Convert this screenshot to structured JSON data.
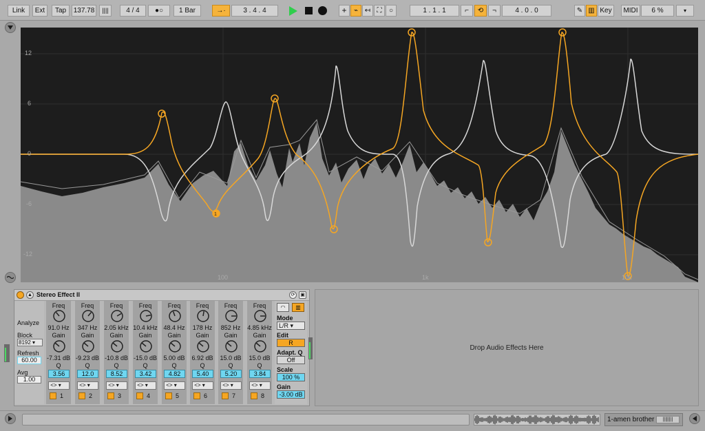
{
  "transport": {
    "link": "Link",
    "ext": "Ext",
    "tap": "Tap",
    "tempo": "137.78",
    "time_sig": "4 / 4",
    "metro": "●○",
    "quantize": "1 Bar",
    "position": "3 .   4 .   4",
    "loop_start": "1 .   1 .   1",
    "loop_length": "4 .   0 .   0",
    "key": "Key",
    "midi": "MIDI",
    "cpu": "6 %"
  },
  "eq_display": {
    "y_ticks": [
      "12",
      "6",
      "0",
      "-6",
      "-12"
    ],
    "x_ticks": [
      "100",
      "1k",
      "10k"
    ]
  },
  "device": {
    "title": "Stereo Effect II",
    "analyze": "Analyze",
    "block_label": "Block",
    "block_value": "8192",
    "refresh_label": "Refresh",
    "refresh_value": "60.00",
    "avg_label": "Avg",
    "avg_value": "1.00",
    "freq_label": "Freq",
    "gain_label": "Gain",
    "q_label": "Q",
    "bands": [
      {
        "freq": "91.0 Hz",
        "gain": "-7.31 dB",
        "q": "3.56",
        "num": "1"
      },
      {
        "freq": "347 Hz",
        "gain": "-9.23 dB",
        "q": "12.0",
        "num": "2"
      },
      {
        "freq": "2.05 kHz",
        "gain": "-10.8 dB",
        "q": "8.52",
        "num": "3"
      },
      {
        "freq": "10.4 kHz",
        "gain": "-15.0 dB",
        "q": "3.42",
        "num": "4"
      },
      {
        "freq": "48.4 Hz",
        "gain": "5.00 dB",
        "q": "4.82",
        "num": "5"
      },
      {
        "freq": "178 Hz",
        "gain": "6.92 dB",
        "q": "5.40",
        "num": "6"
      },
      {
        "freq": "852 Hz",
        "gain": "15.0 dB",
        "q": "5.20",
        "num": "7"
      },
      {
        "freq": "4.85 kHz",
        "gain": "15.0 dB",
        "q": "3.84",
        "num": "8"
      }
    ],
    "mode_label": "Mode",
    "mode_value": "L/R",
    "edit_label": "Edit",
    "edit_value": "R",
    "adaptq_label": "Adapt. Q",
    "adaptq_value": "Off",
    "scale_label": "Scale",
    "scale_value": "100 %",
    "gain_label2": "Gain",
    "gain_value": "-3.00 dB"
  },
  "drop_zone": "Drop Audio Effects Here",
  "clip_name": "1-amen brother",
  "colors": {
    "accent": "#f5a623",
    "curve_white": "#d8d8d8",
    "spectrum": "#8a8a8a",
    "background": "#1d1d1d",
    "cyan": "#6fd6f0"
  }
}
